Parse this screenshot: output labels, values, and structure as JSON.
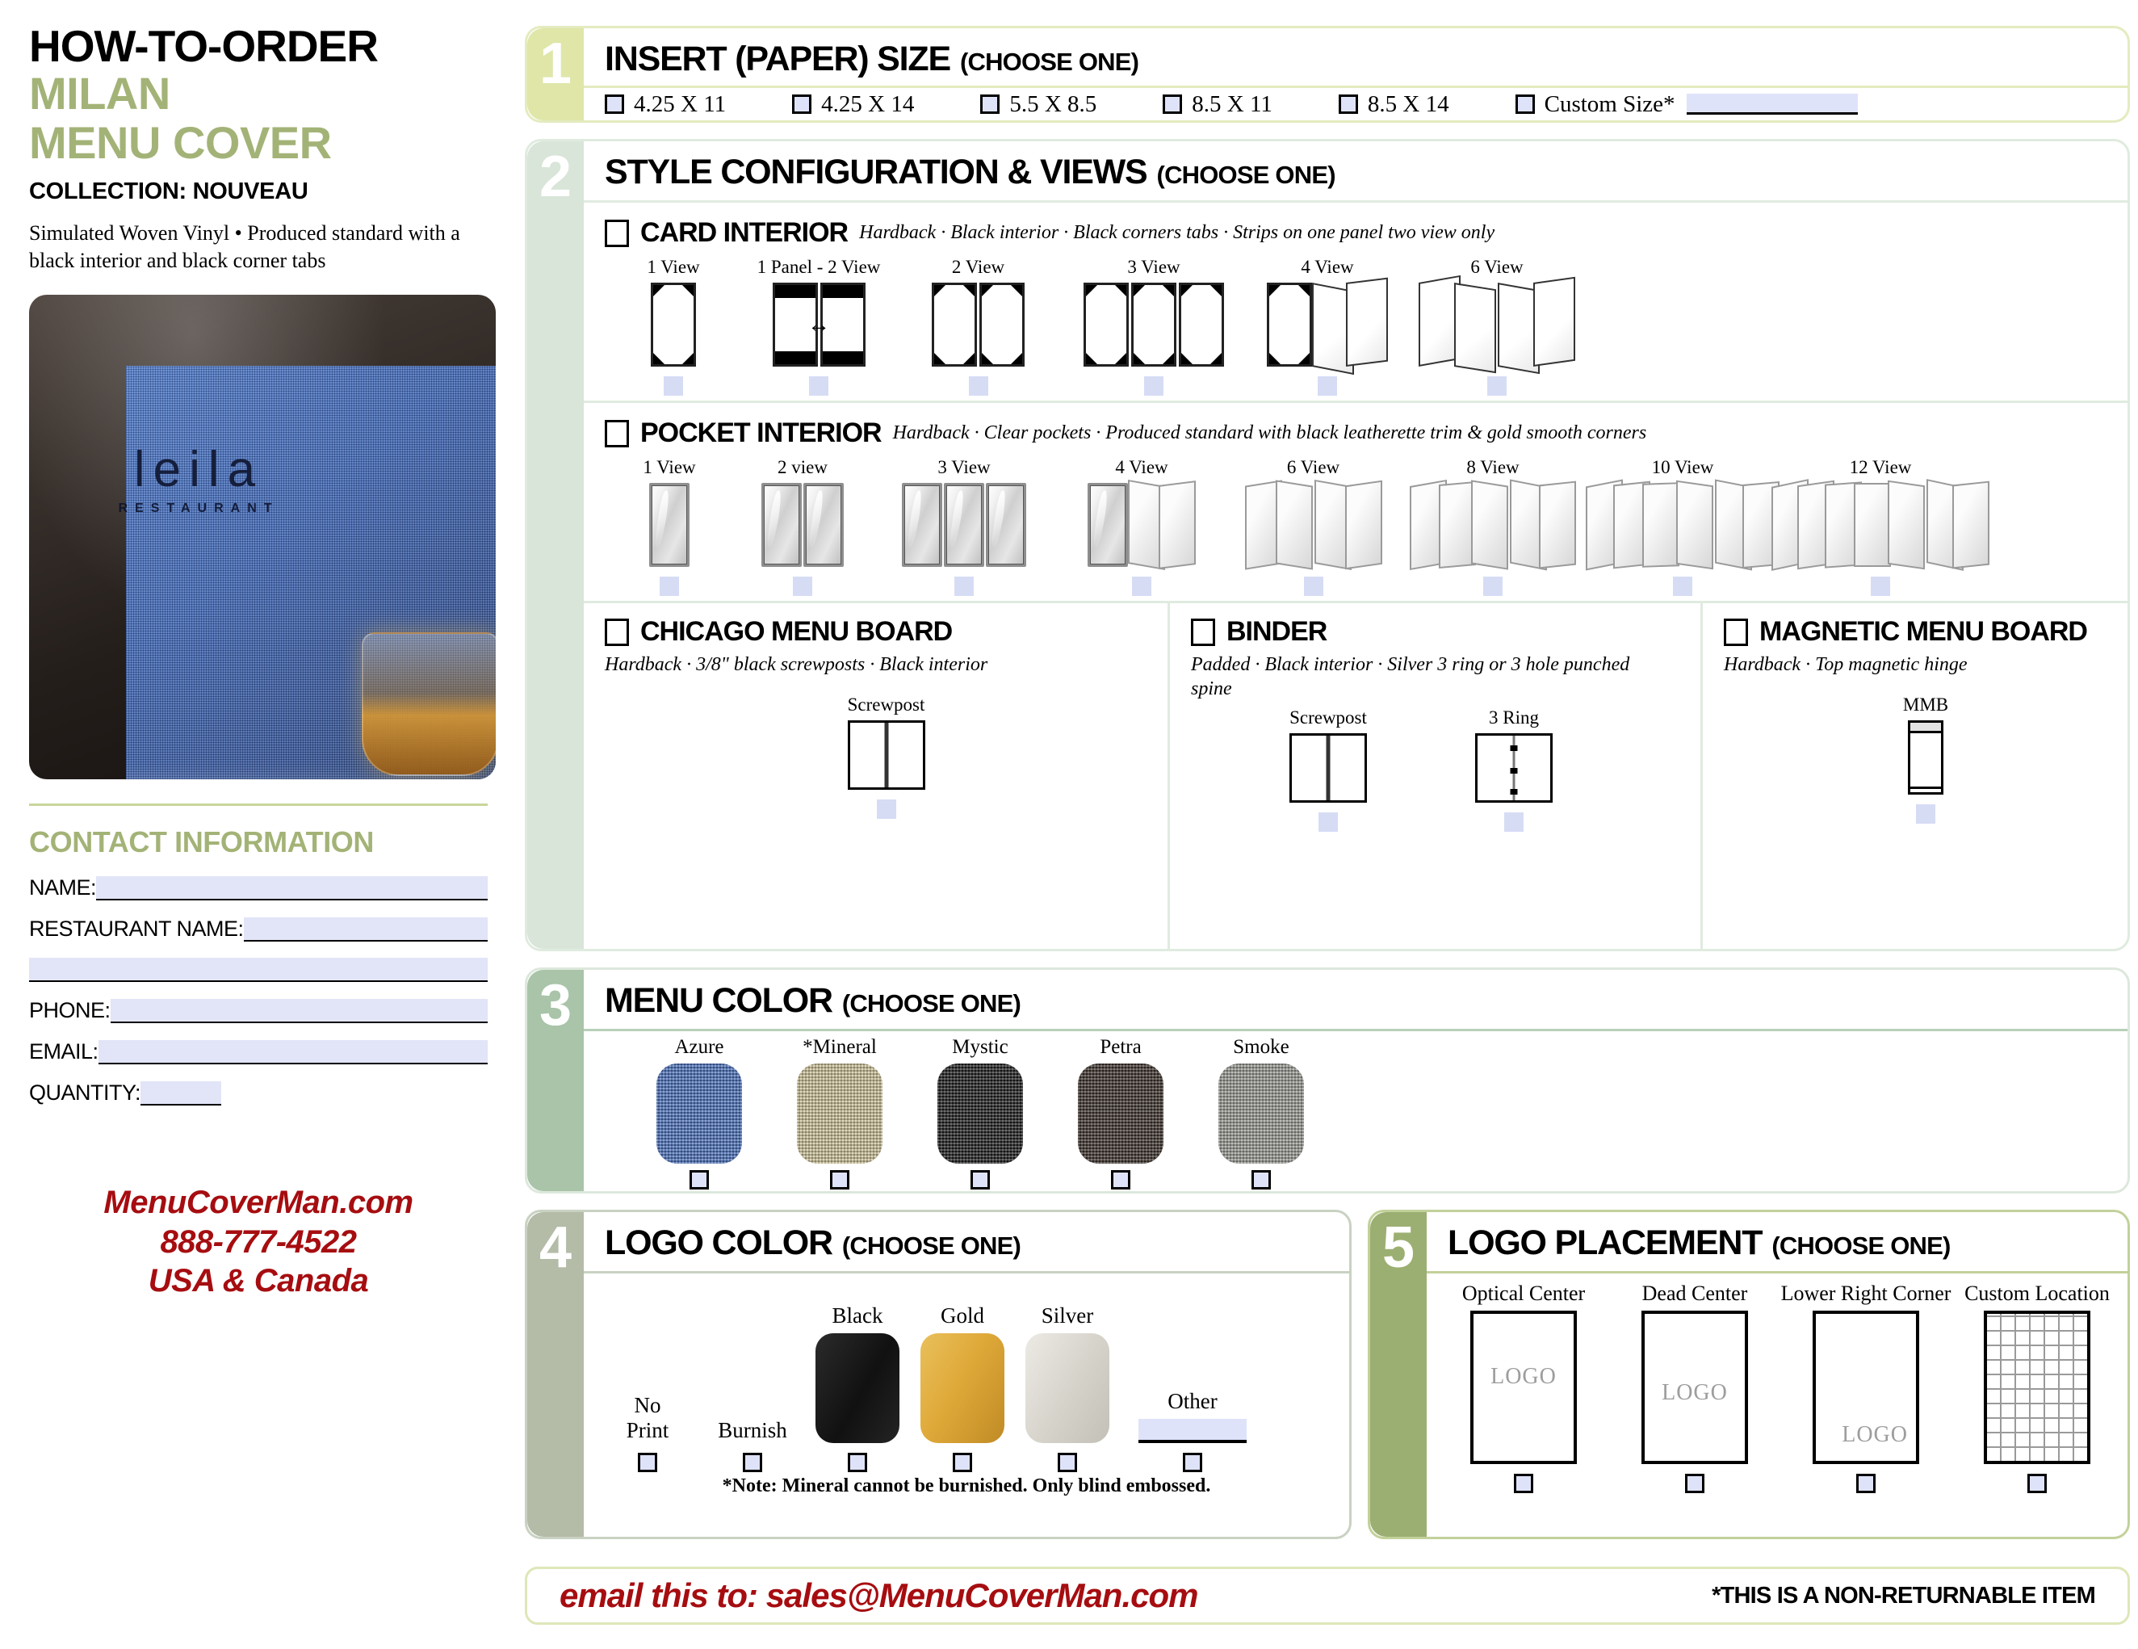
{
  "left": {
    "title_line1": "HOW-TO-ORDER",
    "title_line2": "MILAN",
    "title_line3": "MENU COVER",
    "collection": "COLLECTION: NOUVEAU",
    "description": "Simulated Woven Vinyl • Produced standard with a black interior and black corner tabs",
    "photo": {
      "logo_main": "leila",
      "logo_sub": "RESTAURANT"
    },
    "contact_title": "CONTACT INFORMATION",
    "fields": [
      {
        "label": "NAME:"
      },
      {
        "label": "RESTAURANT NAME:"
      },
      {
        "label": ""
      },
      {
        "label": "PHONE:"
      },
      {
        "label": "EMAIL:"
      },
      {
        "label": "QUANTITY:"
      }
    ],
    "footer": {
      "website": "MenuCoverMan.com",
      "phone": "888-777-4522",
      "region": "USA & Canada"
    }
  },
  "sections": {
    "s1": {
      "number": "1",
      "title": "INSERT (PAPER) SIZE",
      "subtitle": "(CHOOSE ONE)",
      "options": [
        {
          "label": "4.25 X 11"
        },
        {
          "label": "4.25 X 14"
        },
        {
          "label": "5.5 X 8.5"
        },
        {
          "label": "8.5 X 11"
        },
        {
          "label": "8.5 X 14"
        },
        {
          "label": "Custom Size*"
        }
      ]
    },
    "s2": {
      "number": "2",
      "title": "STYLE CONFIGURATION & VIEWS",
      "subtitle": "(CHOOSE ONE)",
      "card": {
        "title": "CARD INTERIOR",
        "desc": "Hardback · Black interior · Black corners tabs · Strips on one panel two view only",
        "views": [
          "1 View",
          "1 Panel - 2 View",
          "2 View",
          "3 View",
          "4 View",
          "6 View"
        ]
      },
      "pocket": {
        "title": "POCKET INTERIOR",
        "desc": "Hardback · Clear pockets · Produced standard with black leatherette trim & gold smooth corners",
        "views": [
          "1 View",
          "2 view",
          "3 View",
          "4 View",
          "6 View",
          "8 View",
          "10 View",
          "12 View"
        ]
      },
      "chicago": {
        "title": "CHICAGO MENU BOARD",
        "desc": "Hardback · 3/8\" black screwposts · Black interior",
        "options": [
          "Screwpost"
        ]
      },
      "binder": {
        "title": "BINDER",
        "desc": "Padded · Black interior · Silver 3 ring or 3 hole punched spine",
        "options": [
          "Screwpost",
          "3 Ring"
        ]
      },
      "magnetic": {
        "title": "MAGNETIC MENU BOARD",
        "desc": "Hardback · Top magnetic hinge",
        "options": [
          "MMB"
        ]
      }
    },
    "s3": {
      "number": "3",
      "title": "MENU COLOR",
      "subtitle": "(CHOOSE ONE)",
      "swatches": [
        {
          "name": "Azure",
          "hex": "#4A72BE"
        },
        {
          "name": "*Mineral",
          "hex": "#CFC49A"
        },
        {
          "name": "Mystic",
          "hex": "#1C1C1C"
        },
        {
          "name": "Petra",
          "hex": "#3B312A"
        },
        {
          "name": "Smoke",
          "hex": "#9A9A94"
        }
      ]
    },
    "s4": {
      "number": "4",
      "title": "LOGO COLOR",
      "subtitle": "(CHOOSE ONE)",
      "options": [
        {
          "name": "No\nPrint",
          "hex": ""
        },
        {
          "name": "Burnish",
          "hex": ""
        },
        {
          "name": "Black",
          "hex": "#1A1A1A"
        },
        {
          "name": "Gold",
          "hex": "#DFA939"
        },
        {
          "name": "Silver",
          "hex": "#D7D4CC"
        },
        {
          "name": "Other",
          "hex": ""
        }
      ],
      "note": "*Note: Mineral cannot be burnished. Only blind embossed."
    },
    "s5": {
      "number": "5",
      "title": "LOGO PLACEMENT",
      "subtitle": "(CHOOSE ONE)",
      "options": [
        {
          "name": "Optical Center",
          "logo": "LOGO"
        },
        {
          "name": "Dead Center",
          "logo": "LOGO"
        },
        {
          "name": "Lower Right Corner",
          "logo": "LOGO"
        },
        {
          "name": "Custom Location",
          "logo": ""
        }
      ]
    }
  },
  "footbar": {
    "email": "email this to:  sales@MenuCoverMan.com",
    "note": "*THIS IS A NON-RETURNABLE ITEM"
  }
}
